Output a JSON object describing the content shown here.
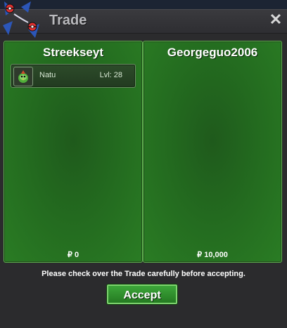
{
  "window": {
    "title": "Trade",
    "close_label": "✕"
  },
  "left_panel": {
    "player_name": "Streekseyt",
    "items": [
      {
        "name": "Natu",
        "level": "Lvl: 28",
        "icon": "natu-sprite-icon"
      }
    ],
    "money": "₽ 0"
  },
  "right_panel": {
    "player_name": "Georgeguo2006",
    "items": [],
    "money": "₽ 10,000"
  },
  "footer": {
    "notice": "Please check over the Trade carefully before accepting.",
    "accept_label": "Accept"
  },
  "colors": {
    "panel_green": "#236a1f",
    "panel_border": "#5fb04f",
    "accept_green": "#3da63a",
    "title_gray": "#b9b9bd"
  }
}
